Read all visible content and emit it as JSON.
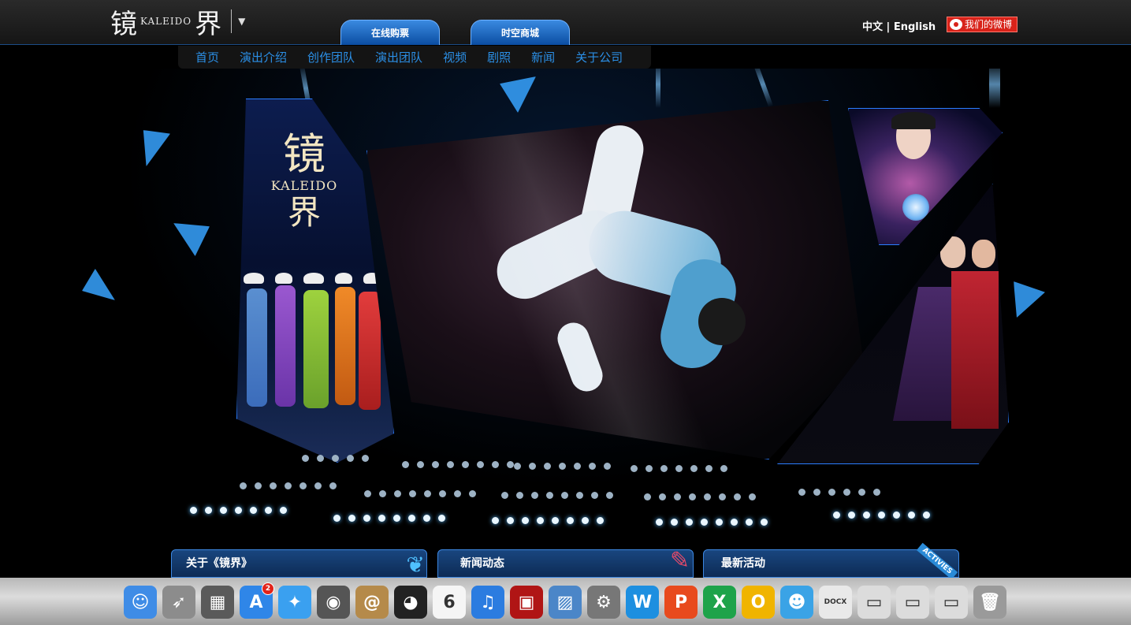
{
  "header": {
    "logo_zh_1": "镜",
    "logo_en": "KALEIDO",
    "logo_zh_2": "界",
    "tabs": [
      {
        "label": "在线购票"
      },
      {
        "label": "时空商城"
      }
    ],
    "lang_zh": "中文",
    "lang_sep": "|",
    "lang_en": "English",
    "weibo_label": "我们的微博"
  },
  "nav": {
    "items": [
      {
        "label": "首页"
      },
      {
        "label": "演出介绍"
      },
      {
        "label": "创作团队"
      },
      {
        "label": "演出团队"
      },
      {
        "label": "视频"
      },
      {
        "label": "剧照"
      },
      {
        "label": "新闻"
      },
      {
        "label": "关于公司"
      }
    ]
  },
  "hero": {
    "poster_zh_1": "镜",
    "poster_en": "KALEIDO",
    "poster_zh_2": "界"
  },
  "bottom_tabs": [
    {
      "label": "关于《镜界》"
    },
    {
      "label": "新闻动态"
    },
    {
      "label": "最新活动",
      "tag": "ACTIVIES"
    }
  ],
  "dock": {
    "items": [
      {
        "icon": "finder-icon",
        "glyph": "☺",
        "color": "#3f8ce6"
      },
      {
        "icon": "launchpad-icon",
        "glyph": "➶",
        "color": "#8c8c8c"
      },
      {
        "icon": "dashboard-icon",
        "glyph": "▦",
        "color": "#5a5a5a"
      },
      {
        "icon": "app-store-icon",
        "glyph": "A",
        "color": "#2f86e8",
        "badge": "2"
      },
      {
        "icon": "safari-icon",
        "glyph": "✦",
        "color": "#3aa0f0"
      },
      {
        "icon": "facetime-icon",
        "glyph": "◉",
        "color": "#555"
      },
      {
        "icon": "contacts-icon",
        "glyph": "@",
        "color": "#b58a4a"
      },
      {
        "icon": "qq-icon",
        "glyph": "◕",
        "color": "#222"
      },
      {
        "icon": "calendar-icon",
        "glyph": "6",
        "color": "#f5f5f5"
      },
      {
        "icon": "itunes-icon",
        "glyph": "♫",
        "color": "#2b7ce0"
      },
      {
        "icon": "photo-booth-icon",
        "glyph": "▣",
        "color": "#b01515"
      },
      {
        "icon": "iphoto-icon",
        "glyph": "▨",
        "color": "#4b86c8"
      },
      {
        "icon": "system-preferences-icon",
        "glyph": "⚙",
        "color": "#777"
      },
      {
        "icon": "word-icon",
        "glyph": "W",
        "color": "#1d8fe0"
      },
      {
        "icon": "powerpoint-icon",
        "glyph": "P",
        "color": "#e84a1d"
      },
      {
        "icon": "excel-icon",
        "glyph": "X",
        "color": "#1ea34a"
      },
      {
        "icon": "outlook-icon",
        "glyph": "O",
        "color": "#f0b400"
      },
      {
        "icon": "messenger-icon",
        "glyph": "☻",
        "color": "#3aa3e6"
      },
      {
        "icon": "docx-file-icon",
        "glyph": "DOCX",
        "color": "#e9e9e9"
      },
      {
        "icon": "window-thumbnail-1-icon",
        "glyph": "▭",
        "color": "#dcdcdc"
      },
      {
        "icon": "window-thumbnail-2-icon",
        "glyph": "▭",
        "color": "#dcdcdc"
      },
      {
        "icon": "window-thumbnail-3-icon",
        "glyph": "▭",
        "color": "#dcdcdc"
      },
      {
        "icon": "trash-icon",
        "glyph": "🗑",
        "color": "#9a9a9a"
      }
    ]
  },
  "colors": {
    "accent": "#2b8fe6",
    "panel_border": "#2a7dff",
    "weibo": "#d8231a"
  }
}
